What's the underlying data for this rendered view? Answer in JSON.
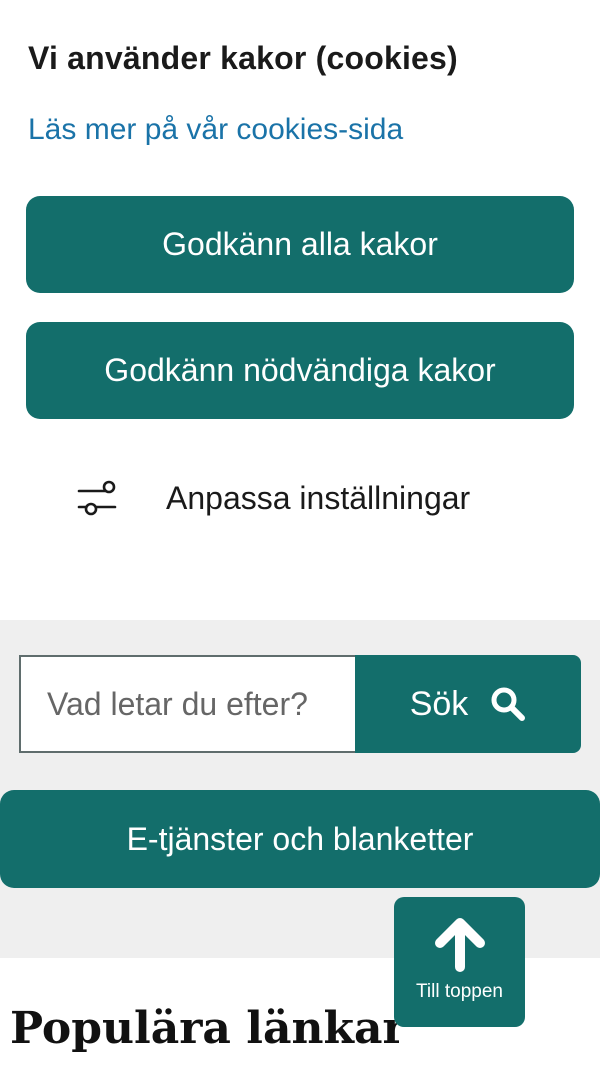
{
  "cookie_banner": {
    "title": "Vi använder kakor (cookies)",
    "link_text": "Läs mer på vår cookies-sida",
    "accept_all_label": "Godkänn alla kakor",
    "accept_necessary_label": "Godkänn nödvändiga kakor",
    "customize_label": "Anpassa inställningar",
    "customize_icon": "sliders-icon"
  },
  "search": {
    "placeholder": "Vad letar du efter?",
    "value": "",
    "button_label": "Sök",
    "button_icon": "search-icon"
  },
  "eservices": {
    "label": "E-tjänster och blanketter"
  },
  "popular_links": {
    "heading": "Populära länkar"
  },
  "to_top": {
    "label": "Till toppen",
    "icon": "arrow-up-icon"
  },
  "colors": {
    "brand": "#136e6b",
    "link": "#1a73a8",
    "section_bg": "#efefef",
    "text": "#1a1a1a"
  }
}
